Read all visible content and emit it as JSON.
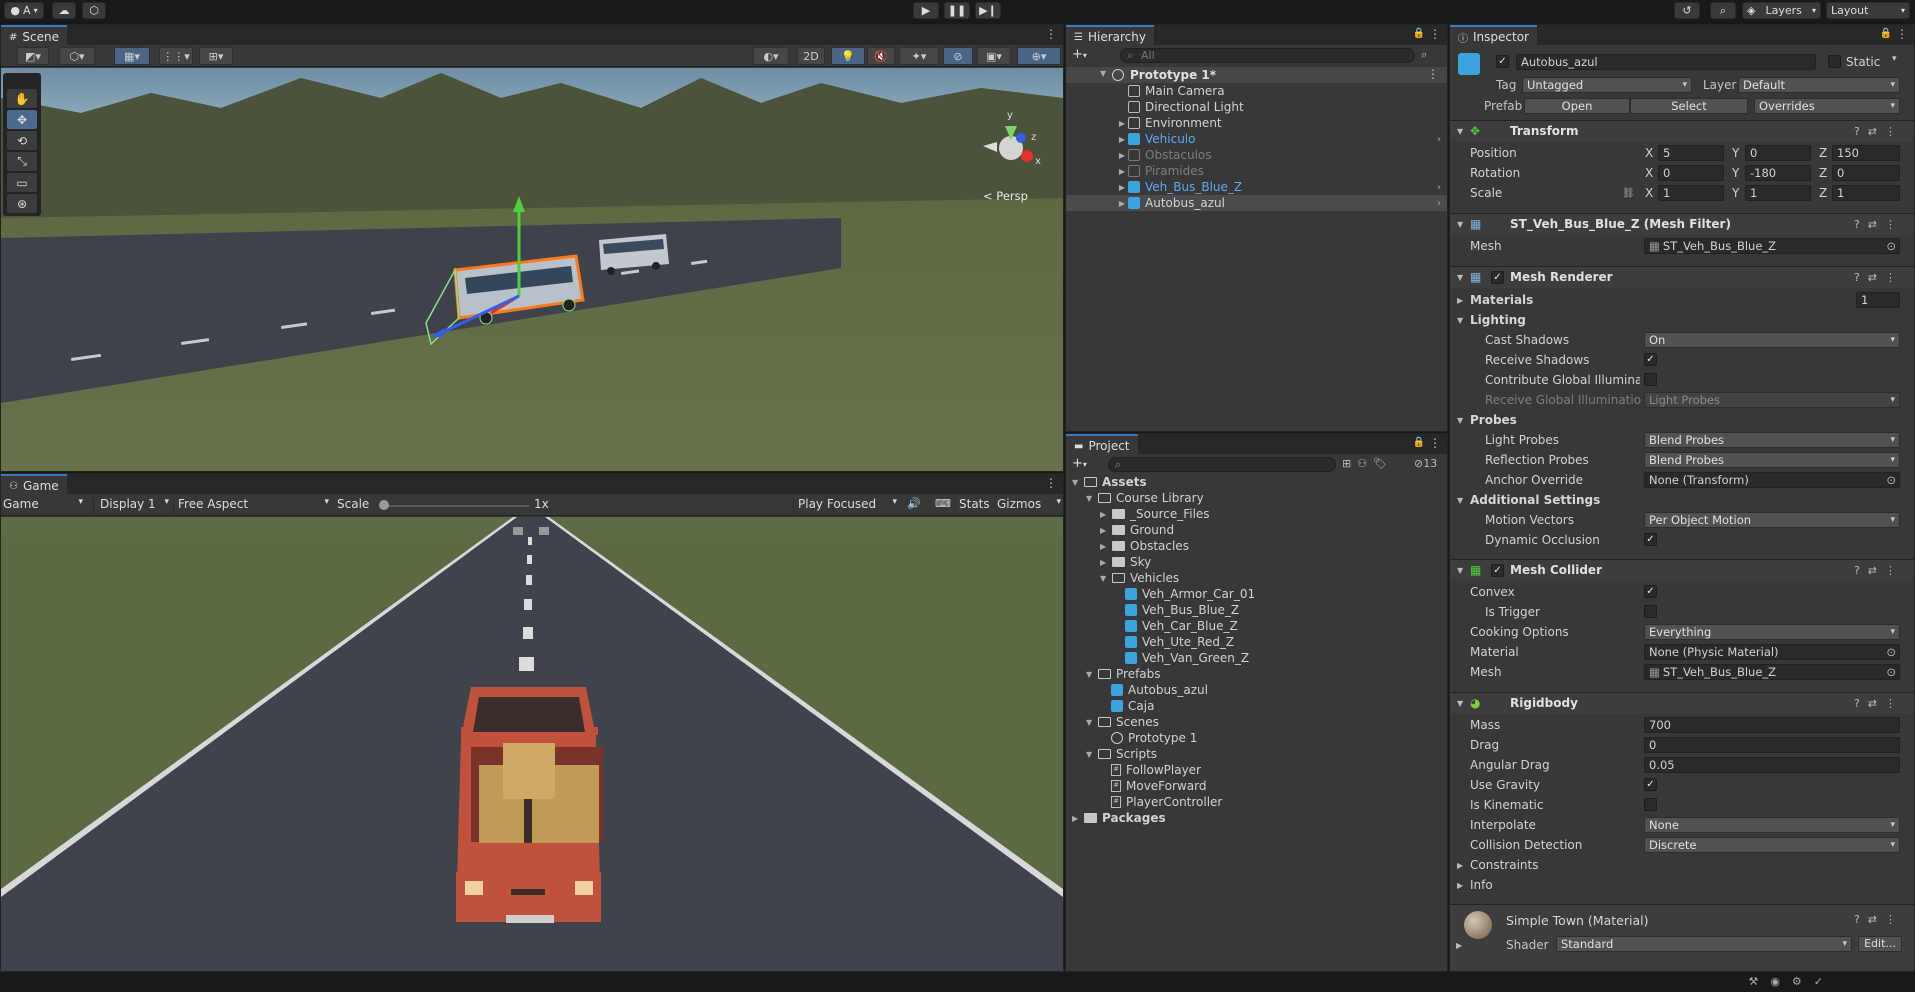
{
  "topbar": {
    "account_label": "A",
    "layers_label": "Layers",
    "layout_label": "Layout"
  },
  "scene": {
    "tab": "Scene",
    "toolbar_2d": "2D",
    "persp_label": "Persp"
  },
  "game": {
    "tab": "Game",
    "mode": "Game",
    "display": "Display 1",
    "aspect": "Free Aspect",
    "scale_label": "Scale",
    "scale_value": "1x",
    "play_mode": "Play Focused",
    "stats": "Stats",
    "gizmos": "Gizmos"
  },
  "hierarchy": {
    "tab": "Hierarchy",
    "search_placeholder": "All",
    "scene_name": "Prototype 1*",
    "items": [
      {
        "label": "Main Camera"
      },
      {
        "label": "Directional Light"
      },
      {
        "label": "Environment"
      },
      {
        "label": "Vehiculo"
      },
      {
        "label": "Obstaculos"
      },
      {
        "label": "Piramides"
      },
      {
        "label": "Veh_Bus_Blue_Z"
      },
      {
        "label": "Autobus_azul"
      }
    ]
  },
  "project": {
    "tab": "Project",
    "hidden_count": "13",
    "tree": [
      {
        "label": "Assets"
      },
      {
        "label": "Course Library"
      },
      {
        "label": "_Source_Files"
      },
      {
        "label": "Ground"
      },
      {
        "label": "Obstacles"
      },
      {
        "label": "Sky"
      },
      {
        "label": "Vehicles"
      },
      {
        "label": "Veh_Armor_Car_01"
      },
      {
        "label": "Veh_Bus_Blue_Z"
      },
      {
        "label": "Veh_Car_Blue_Z"
      },
      {
        "label": "Veh_Ute_Red_Z"
      },
      {
        "label": "Veh_Van_Green_Z"
      },
      {
        "label": "Prefabs"
      },
      {
        "label": "Autobus_azul"
      },
      {
        "label": "Caja"
      },
      {
        "label": "Scenes"
      },
      {
        "label": "Prototype 1"
      },
      {
        "label": "Scripts"
      },
      {
        "label": "FollowPlayer"
      },
      {
        "label": "MoveForward"
      },
      {
        "label": "PlayerController"
      },
      {
        "label": "Packages"
      }
    ]
  },
  "inspector": {
    "tab": "Inspector",
    "object_name": "Autobus_azul",
    "static_label": "Static",
    "tag_label": "Tag",
    "tag_value": "Untagged",
    "layer_label": "Layer",
    "layer_value": "Default",
    "prefab_label": "Prefab",
    "prefab_open": "Open",
    "prefab_select": "Select",
    "prefab_overrides": "Overrides",
    "transform": {
      "title": "Transform",
      "position_label": "Position",
      "rotation_label": "Rotation",
      "scale_label": "Scale",
      "x": "X",
      "y": "Y",
      "z": "Z",
      "position": [
        "5",
        "0",
        "150"
      ],
      "rotation": [
        "0",
        "-180",
        "0"
      ],
      "scale": [
        "1",
        "1",
        "1"
      ]
    },
    "mesh_filter": {
      "title": "ST_Veh_Bus_Blue_Z (Mesh Filter)",
      "mesh_label": "Mesh",
      "mesh_value": "ST_Veh_Bus_Blue_Z"
    },
    "mesh_renderer": {
      "title": "Mesh Renderer",
      "materials_label": "Materials",
      "materials_count": "1",
      "lighting_label": "Lighting",
      "cast_shadows_label": "Cast Shadows",
      "cast_shadows_value": "On",
      "receive_shadows_label": "Receive Shadows",
      "contribute_gi_label": "Contribute Global Illumination",
      "receive_gi_label": "Receive Global Illumination",
      "receive_gi_value": "Light Probes",
      "probes_label": "Probes",
      "light_probes_label": "Light Probes",
      "light_probes_value": "Blend Probes",
      "reflection_probes_label": "Reflection Probes",
      "reflection_probes_value": "Blend Probes",
      "anchor_override_label": "Anchor Override",
      "anchor_override_value": "None (Transform)",
      "additional_label": "Additional Settings",
      "motion_vectors_label": "Motion Vectors",
      "motion_vectors_value": "Per Object Motion",
      "dynamic_occlusion_label": "Dynamic Occlusion"
    },
    "mesh_collider": {
      "title": "Mesh Collider",
      "convex_label": "Convex",
      "is_trigger_label": "Is Trigger",
      "cooking_label": "Cooking Options",
      "cooking_value": "Everything",
      "material_label": "Material",
      "material_value": "None (Physic Material)",
      "mesh_label": "Mesh",
      "mesh_value": "ST_Veh_Bus_Blue_Z"
    },
    "rigidbody": {
      "title": "Rigidbody",
      "mass_label": "Mass",
      "mass_value": "700",
      "drag_label": "Drag",
      "drag_value": "0",
      "angular_drag_label": "Angular Drag",
      "angular_drag_value": "0.05",
      "use_gravity_label": "Use Gravity",
      "is_kinematic_label": "Is Kinematic",
      "interpolate_label": "Interpolate",
      "interpolate_value": "None",
      "collision_label": "Collision Detection",
      "collision_value": "Discrete",
      "constraints_label": "Constraints",
      "info_label": "Info"
    },
    "material": {
      "title": "Simple Town (Material)",
      "shader_label": "Shader",
      "shader_value": "Standard",
      "edit_label": "Edit..."
    }
  },
  "colors": {
    "accent": "#3a79bb",
    "sky_scene": "#6e8ea5",
    "grass": "#5e6a42",
    "selection_orange": "#ff7a1a",
    "prefab_blue": "#5aaaf2"
  }
}
